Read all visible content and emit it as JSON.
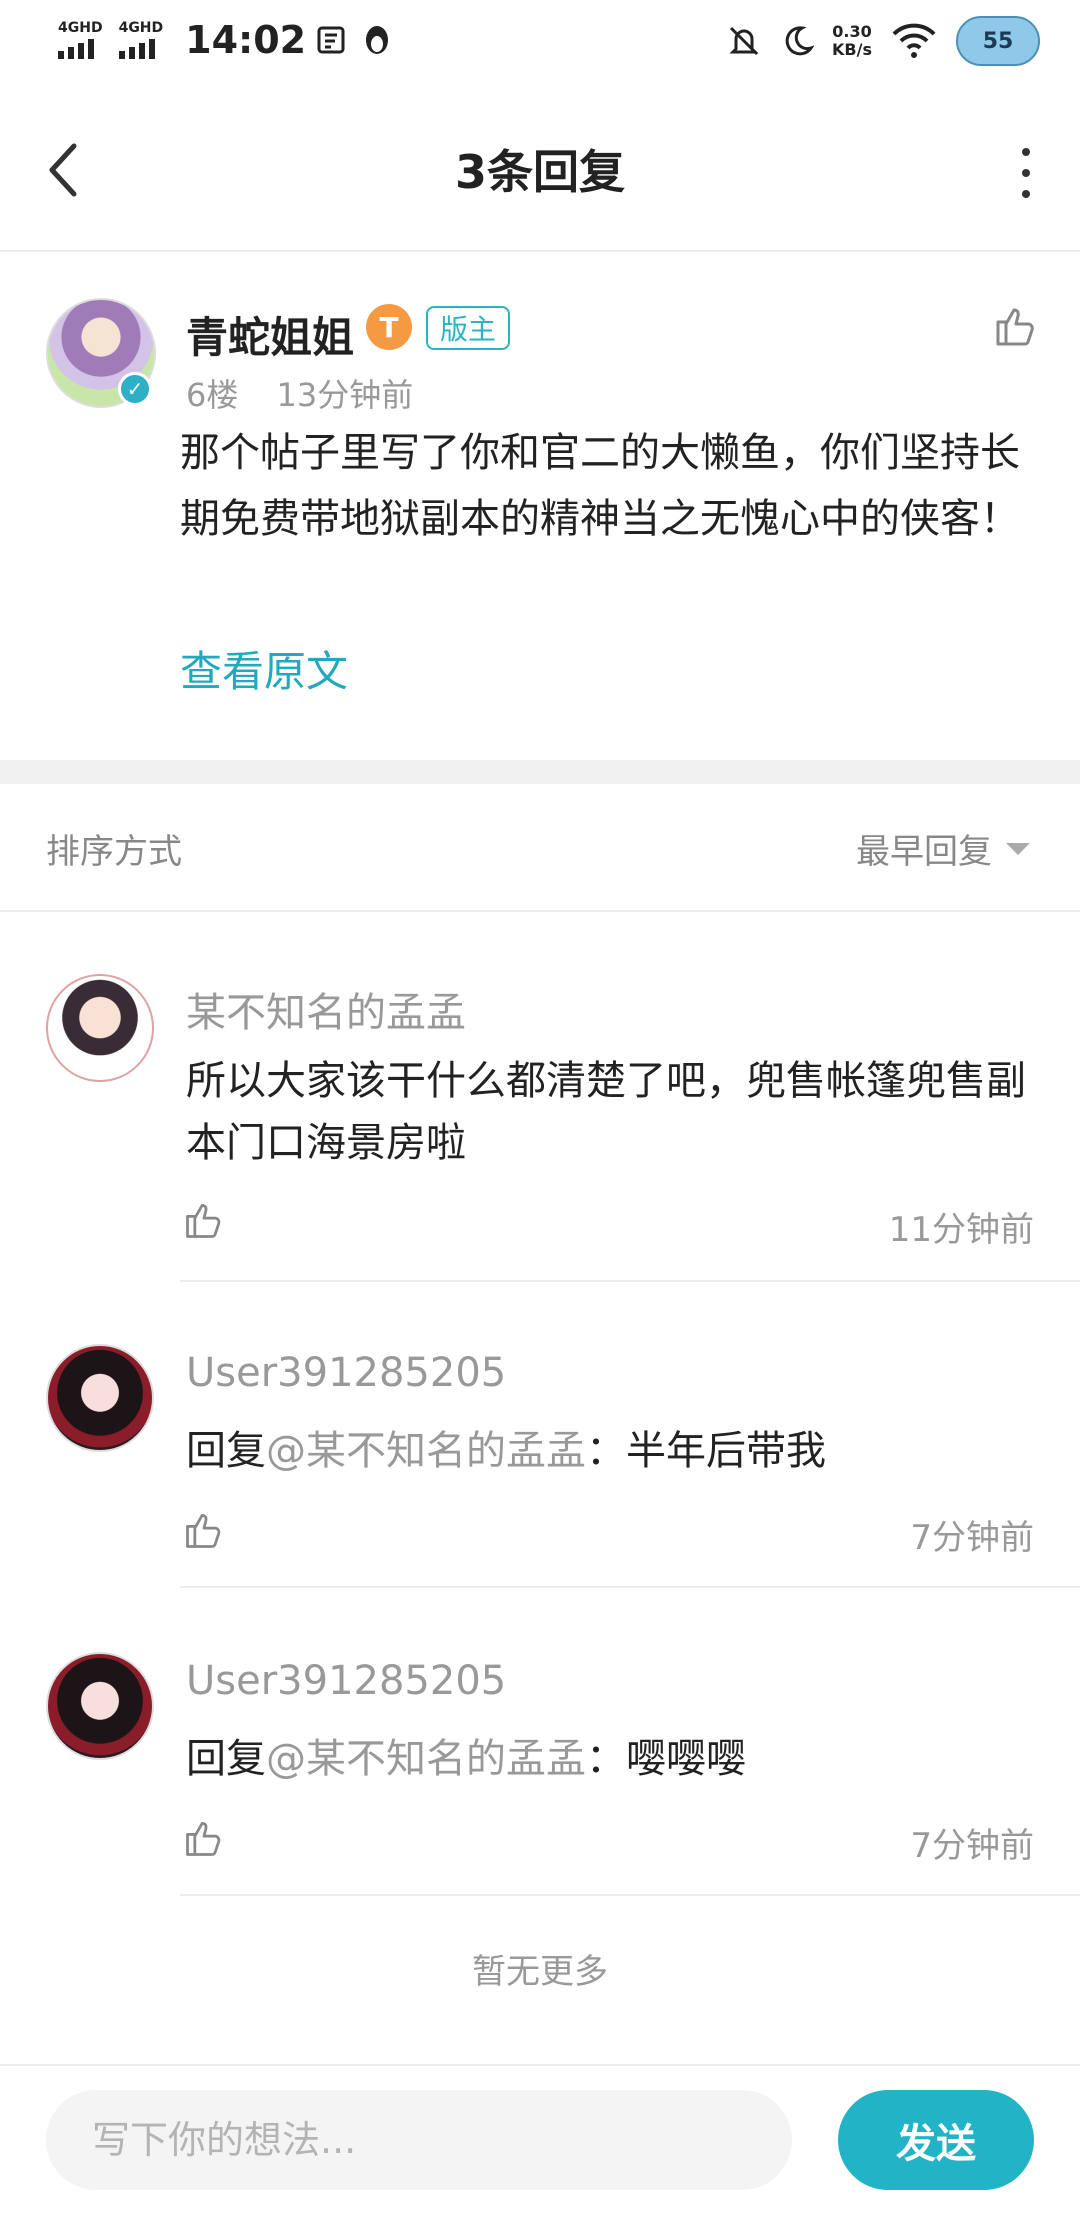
{
  "status_bar": {
    "network1": "4GHD",
    "network2": "4GHD",
    "time": "14:02",
    "speed_value": "0.30",
    "speed_unit": "KB/s",
    "battery": "55"
  },
  "header": {
    "title": "3条回复"
  },
  "post": {
    "author": "青蛇姐姐",
    "level_badge": "T",
    "role_badge": "版主",
    "floor": "6楼",
    "time": "13分钟前",
    "content": "那个帖子里写了你和官二的大懒鱼，你们坚持长期免费带地狱副本的精神当之无愧心中的侠客！",
    "view_original": "查看原文"
  },
  "sort": {
    "label": "排序方式",
    "value": "最早回复"
  },
  "replies": [
    {
      "name": "某不知名的孟孟",
      "text": "所以大家该干什么都清楚了吧，兜售帐篷兜售副本门口海景房啦",
      "prefix": "",
      "mention": "",
      "time": "11分钟前"
    },
    {
      "name": "User391285205",
      "prefix": "回复",
      "mention": "@某不知名的孟孟",
      "text": "：半年后带我",
      "time": "7分钟前"
    },
    {
      "name": "User391285205",
      "prefix": "回复",
      "mention": "@某不知名的孟孟",
      "text": "：嘤嘤嘤",
      "time": "7分钟前"
    }
  ],
  "footer": {
    "no_more": "暂无更多",
    "input_placeholder": "写下你的想法...",
    "send_label": "发送"
  },
  "colors": {
    "accent": "#22b4c6",
    "text_primary": "#222222",
    "text_secondary": "#999999"
  }
}
